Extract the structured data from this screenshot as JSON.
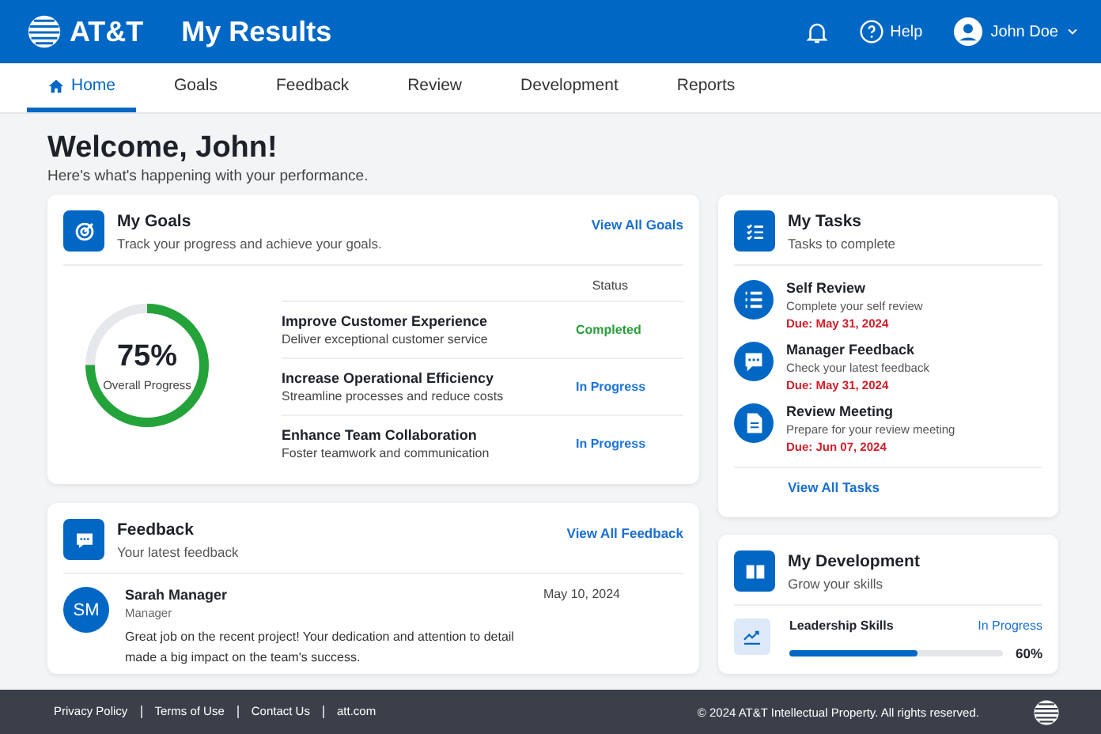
{
  "header": {
    "brand": "AT&T",
    "title": "My Results",
    "help": "Help",
    "user": "John Doe"
  },
  "tabs": [
    {
      "label": "Home",
      "selected": true
    },
    {
      "label": "Goals",
      "selected": false
    },
    {
      "label": "Feedback",
      "selected": false
    },
    {
      "label": "Review",
      "selected": false
    },
    {
      "label": "Development",
      "selected": false
    },
    {
      "label": "Reports",
      "selected": false
    }
  ],
  "welcome": {
    "title": "Welcome, John!",
    "subtitle": "Here's what's happening with your performance."
  },
  "goals": {
    "title": "My Goals",
    "subtitle": "Track your progress and achieve your goals.",
    "link": "View All Goals",
    "progress": {
      "value": "75%",
      "label": "Overall Progress"
    },
    "status_heading": "Status",
    "items": [
      {
        "name": "Improve Customer Experience",
        "description": "Deliver exceptional customer service",
        "status": "Completed",
        "kind": "completed"
      },
      {
        "name": "Increase Operational Efficiency",
        "description": "Streamline processes and reduce costs",
        "status": "In Progress",
        "kind": "in_progress"
      },
      {
        "name": "Enhance Team Collaboration",
        "description": "Foster teamwork and communication",
        "status": "In Progress",
        "kind": "in_progress"
      }
    ]
  },
  "feedback": {
    "title": "Feedback",
    "subtitle": "Your latest feedback",
    "link": "View All Feedback",
    "entry": {
      "initials": "SM",
      "name": "Sarah Manager",
      "role": "Manager",
      "date": "May 10, 2024",
      "text": "Great job on the recent project! Your dedication and attention to detail made a big impact on the team's success."
    }
  },
  "tasks": {
    "title": "My Tasks",
    "subtitle": "Tasks to complete",
    "link": "View All Tasks",
    "items": [
      {
        "kind": "list",
        "name": "Self Review",
        "description": "Complete your self review",
        "due": "Due: May 31, 2024"
      },
      {
        "kind": "chat",
        "name": "Manager Feedback",
        "description": "Check your latest feedback",
        "due": "Due: May 31, 2024"
      },
      {
        "kind": "document",
        "name": "Review Meeting",
        "description": "Prepare for your review meeting",
        "due": "Due: Jun 07, 2024"
      }
    ]
  },
  "development": {
    "title": "My Development",
    "subtitle": "Grow your skills",
    "skill": {
      "name": "Leadership Skills",
      "status": "In Progress",
      "level": 0.6,
      "percent": "60%"
    }
  },
  "footer": {
    "links": [
      "Privacy Policy",
      "Terms of Use",
      "Contact Us",
      "att.com"
    ],
    "copyright": "© 2024 AT&T Intellectual Property. All rights reserved."
  }
}
